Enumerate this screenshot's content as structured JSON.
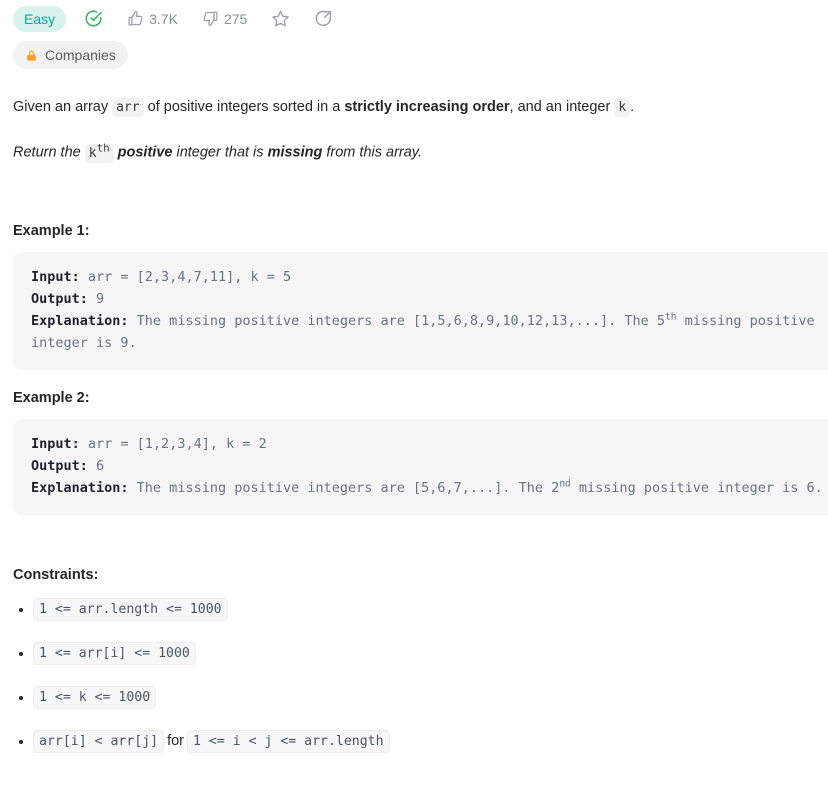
{
  "meta": {
    "difficulty": "Easy",
    "solved_icon": "check-circle-icon",
    "likes": "3.7K",
    "dislikes": "275",
    "favorite_icon": "star-icon",
    "share_icon": "share-icon",
    "accent_easy_text": "#00af9b",
    "accent_easy_bg": "#d9f2ec",
    "accent_solved": "#2db55d",
    "accent_lock": "#f6a21d"
  },
  "tags": {
    "companies_label": "Companies",
    "lock_icon": "lock-icon"
  },
  "description": {
    "p1": {
      "t1": "Given an array ",
      "code1": "arr",
      "t2": " of positive integers sorted in a ",
      "strong1": "strictly increasing order",
      "t3": ", and an integer ",
      "code2": "k",
      "t4": "."
    },
    "p2": {
      "t1": "Return the ",
      "code1": "kth",
      "code1_base": "k",
      "code1_sup": "th",
      "strong1": "positive",
      "t2": " integer that is ",
      "strong2": "missing",
      "t3": " from this array."
    }
  },
  "examples": [
    {
      "title": "Example 1:",
      "input_label": "Input:",
      "input_value": " arr = [2,3,4,7,11], k = 5",
      "output_label": "Output:",
      "output_value": " 9",
      "explanation_label": "Explanation:",
      "explanation_pre": " The missing positive integers are [1,5,6,8,9,10,12,13,...]. The 5",
      "explanation_sup": "th",
      "explanation_post": " missing positive integer is 9."
    },
    {
      "title": "Example 2:",
      "input_label": "Input:",
      "input_value": " arr = [1,2,3,4], k = 2",
      "output_label": "Output:",
      "output_value": " 6",
      "explanation_label": "Explanation:",
      "explanation_pre": " The missing positive integers are [5,6,7,...]. The 2",
      "explanation_sup": "nd",
      "explanation_post": " missing positive integer is 6."
    }
  ],
  "constraints": {
    "title": "Constraints:",
    "items": [
      {
        "code1": "1 <= arr.length <= 1000",
        "mid": "",
        "code2": ""
      },
      {
        "code1": "1 <= arr[i] <= 1000",
        "mid": "",
        "code2": ""
      },
      {
        "code1": "1 <= k <= 1000",
        "mid": "",
        "code2": ""
      },
      {
        "code1": "arr[i] < arr[j]",
        "mid": "for",
        "code2": "1 <= i < j <= arr.length"
      }
    ]
  }
}
